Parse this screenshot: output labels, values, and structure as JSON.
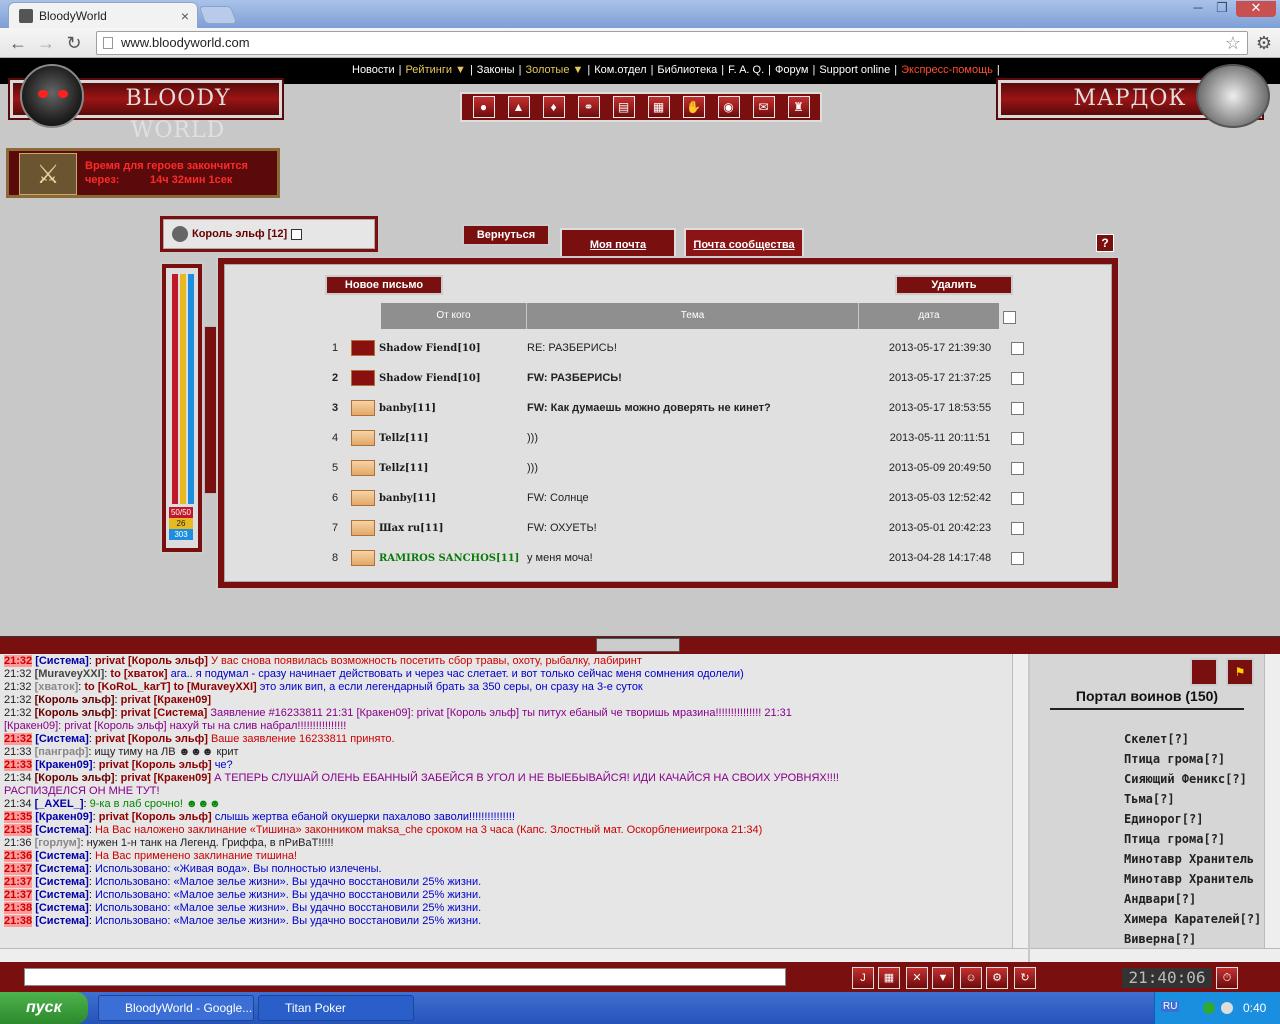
{
  "browser": {
    "tab_title": "BloodyWorld",
    "url": "www.bloodyworld.com",
    "min": "─",
    "max": "❐",
    "close": "✕",
    "tab_close": "×"
  },
  "topnav": {
    "items": [
      "Новости",
      "Рейтинги ▼",
      "Законы",
      "Золотые ▼",
      "Ком.отдел",
      "Библиотека",
      "F. A. Q.",
      "Форум",
      "Support online",
      "Экспресс-помощь"
    ]
  },
  "banner": {
    "left": "BLOODY WORLD",
    "right": "МАРДОК"
  },
  "timer": {
    "line1": "Время для героев закончится",
    "line2": "через:",
    "value": "14ч 32мин 1сек"
  },
  "character": {
    "name": "Король эльф [12]"
  },
  "bars": {
    "values": [
      "50/50",
      "26",
      "303"
    ]
  },
  "buttons": {
    "back": "Вернуться",
    "new_letter": "Новое письмо",
    "delete": "Удалить",
    "help": "?"
  },
  "tabs": {
    "my_mail": "Моя почта",
    "community_mail": "Почта сообщества"
  },
  "mail": {
    "headers": {
      "from": "От кого",
      "subject": "Тема",
      "date": "дата"
    },
    "rows": [
      {
        "num": "1",
        "from": "Shadow Fiend[10]",
        "subject": "RE: РАЗБЕРИСЬ!",
        "date": "2013-05-17 21:39:30",
        "unread": false,
        "icon": "red-seal-icon"
      },
      {
        "num": "2",
        "from": "Shadow Fiend[10]",
        "subject": "FW: РАЗБЕРИСЬ!",
        "date": "2013-05-17 21:37:25",
        "unread": true,
        "icon": "red-seal-icon"
      },
      {
        "num": "3",
        "from": "banby[11]",
        "subject": "FW: Как думаешь можно доверять не кинет?",
        "date": "2013-05-17 18:53:55",
        "unread": true,
        "icon": "envelope-icon"
      },
      {
        "num": "4",
        "from": "Tellz[11]",
        "subject": ")))",
        "date": "2013-05-11 20:11:51",
        "unread": false,
        "icon": "envelope-icon"
      },
      {
        "num": "5",
        "from": "Tellz[11]",
        "subject": ")))",
        "date": "2013-05-09 20:49:50",
        "unread": false,
        "icon": "envelope-icon"
      },
      {
        "num": "6",
        "from": "banby[11]",
        "subject": "FW: Солнце",
        "date": "2013-05-03 12:52:42",
        "unread": false,
        "icon": "envelope-icon"
      },
      {
        "num": "7",
        "from": "Шах ru[11]",
        "subject": "FW: ОХУЕТЬ!",
        "date": "2013-05-01 20:42:23",
        "unread": false,
        "icon": "envelope-icon"
      },
      {
        "num": "8",
        "from": "RAMIROS SANCHOS[11]",
        "subject": "у меня моча!",
        "date": "2013-04-28 14:17:48",
        "unread": false,
        "icon": "envelope-icon"
      }
    ]
  },
  "chat": {
    "lines": [
      {
        "t": "21:32",
        "tr": true,
        "who": "[Система]",
        "wc": "#00a",
        "pv": "privat [Король эльф]",
        "msg": "У вас снова появилась возможность посетить сбор травы, охоту, рыбалку, лабиринт",
        "mc": "#c00"
      },
      {
        "t": "21:32",
        "tr": false,
        "who": "[MuraveyXXI]",
        "wc": "#444",
        "pv": "to [хваток]",
        "msg": "ага.. я подумал - сразу начинает действовать и через час слетает. и вот только сейчас меня сомнения одолели)",
        "mc": "#00c"
      },
      {
        "t": "21:32",
        "tr": false,
        "who": "[хваток]",
        "wc": "#888",
        "pv": "to [KoRoL_karT] to [MuraveyXXI]",
        "msg": "это элик вип, а если легендарный брать за 350 серы, он сразу на 3-е суток",
        "mc": "#00c"
      },
      {
        "t": "21:32",
        "tr": false,
        "who": "[Король эльф]",
        "wc": "#600",
        "pv": "privat [Кракен09]",
        "msg": "",
        "mc": "#00c"
      },
      {
        "t": "21:32",
        "tr": false,
        "who": "[Король эльф]",
        "wc": "#600",
        "pv": "privat [Система]",
        "msg": "Заявление #16233811 21:31 [Кракен09]: privat [Король эльф] ты питух ебаный че творишь мразина!!!!!!!!!!!!!!! 21:31",
        "mc": "#808"
      },
      {
        "t": "",
        "tr": false,
        "who": "",
        "wc": "#808",
        "pv": "",
        "msg": "[Кракен09]: privat [Король эльф] нахуй ты на слив набрал!!!!!!!!!!!!!!!!",
        "mc": "#808"
      },
      {
        "t": "21:32",
        "tr": true,
        "who": "[Система]",
        "wc": "#00a",
        "pv": "privat [Король эльф]",
        "msg": "Ваше заявление 16233811 принято.",
        "mc": "#c00"
      },
      {
        "t": "21:33",
        "tr": false,
        "who": "[панграф]",
        "wc": "#888",
        "pv": "",
        "msg": "ищу тиму на ЛВ ☻☻☻ крит",
        "mc": "#222"
      },
      {
        "t": "21:33",
        "tr": true,
        "who": "[Кракен09]",
        "wc": "#00a",
        "pv": "privat [Король эльф]",
        "msg": "че?",
        "mc": "#00c"
      },
      {
        "t": "21:34",
        "tr": false,
        "who": "[Король эльф]",
        "wc": "#600",
        "pv": "privat [Кракен09]",
        "msg": "А ТЕПЕРЬ СЛУШАЙ ОЛЕНЬ ЕБАННЫЙ ЗАБЕЙСЯ В УГОЛ И НЕ ВЫЕБЫВАЙСЯ! ИДИ КАЧАЙСЯ НА СВОИХ УРОВНЯХ!!!!",
        "mc": "#808"
      },
      {
        "t": "",
        "tr": false,
        "who": "",
        "wc": "#808",
        "pv": "",
        "msg": "РАСПИЗДЕЛСЯ ОН МНЕ ТУТ!",
        "mc": "#808"
      },
      {
        "t": "21:34",
        "tr": false,
        "who": "[_AXEL_]",
        "wc": "#00a",
        "pv": "",
        "msg": "9-ка в лаб срочно! ☻☻☻",
        "mc": "#080"
      },
      {
        "t": "21:35",
        "tr": true,
        "who": "[Кракен09]",
        "wc": "#00a",
        "pv": "privat [Король эльф]",
        "msg": "слышь жертва ебаной окушерки пахалово заволи!!!!!!!!!!!!!!!",
        "mc": "#00c"
      },
      {
        "t": "21:35",
        "tr": true,
        "who": "[Система]",
        "wc": "#00a",
        "pv": "",
        "msg": "На Вас наложено заклинание «Тишина» законником maksa_che сроком на 3 часа (Капс. Злостный мат. Оскорблениеигрока 21:34)",
        "mc": "#c00"
      },
      {
        "t": "21:36",
        "tr": false,
        "who": "[горлум]",
        "wc": "#888",
        "pv": "",
        "msg": "нужен 1-н танк на Легенд. Гриффа, в пРиВаТ!!!!!",
        "mc": "#222"
      },
      {
        "t": "21:36",
        "tr": true,
        "who": "[Система]",
        "wc": "#00a",
        "pv": "",
        "msg": "На Вас применено заклинание тишина!",
        "mc": "#c00"
      },
      {
        "t": "21:37",
        "tr": true,
        "who": "[Система]",
        "wc": "#00a",
        "pv": "",
        "msg": "Использовано: «Живая вода». Вы полностью излечены.",
        "mc": "#00c"
      },
      {
        "t": "21:37",
        "tr": true,
        "who": "[Система]",
        "wc": "#00a",
        "pv": "",
        "msg": "Использовано: «Малое зелье жизни». Вы удачно восстановили 25% жизни.",
        "mc": "#00c"
      },
      {
        "t": "21:37",
        "tr": true,
        "who": "[Система]",
        "wc": "#00a",
        "pv": "",
        "msg": "Использовано: «Малое зелье жизни». Вы удачно восстановили 25% жизни.",
        "mc": "#00c"
      },
      {
        "t": "21:38",
        "tr": true,
        "who": "[Система]",
        "wc": "#00a",
        "pv": "",
        "msg": "Использовано: «Малое зелье жизни». Вы удачно восстановили 25% жизни.",
        "mc": "#00c"
      },
      {
        "t": "21:38",
        "tr": true,
        "who": "[Система]",
        "wc": "#00a",
        "pv": "",
        "msg": "Использовано: «Малое зелье жизни». Вы удачно восстановили 25% жизни.",
        "mc": "#00c"
      }
    ]
  },
  "portal": {
    "title": "Портал воинов (150)",
    "warriors": [
      "Скелет[?]",
      "Птица грома[?]",
      "Сияющий Феникс[?]",
      "Тьма[?]",
      "Единорог[?]",
      "Птица грома[?]",
      "Минотавр Хранитель",
      "Минотавр Хранитель",
      "Андвари[?]",
      "Химера Карателей[?]",
      "Виверна[?]"
    ]
  },
  "clock": "21:40:06",
  "taskbar": {
    "start": "пуск",
    "tasks": [
      "BloodyWorld - Google...",
      "Titan Poker"
    ],
    "lang": "RU",
    "time": "0:40"
  }
}
